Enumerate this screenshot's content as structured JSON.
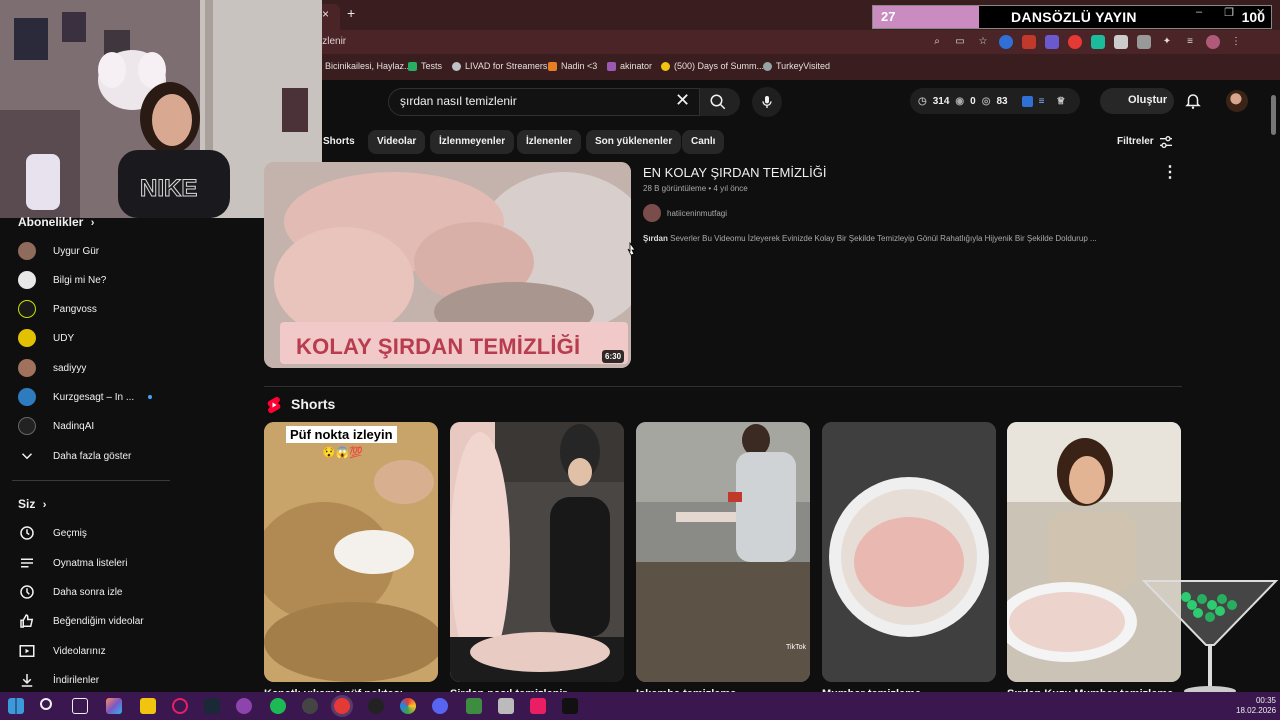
{
  "browser": {
    "tab_close_glyph": "×",
    "new_tab_glyph": "+",
    "url": "izlenir",
    "bookmarks": [
      {
        "label": "Bicinikailesi, Haylaz...",
        "color": "#c0392b"
      },
      {
        "label": "Tests",
        "color": "#27ae60"
      },
      {
        "label": "LIVAD for Streamers",
        "color": "#bdc3c7"
      },
      {
        "label": "Nadin <3",
        "color": "#e67e22"
      },
      {
        "label": "akinator",
        "color": "#9b59b6"
      },
      {
        "label": "(500) Days of Summ...",
        "color": "#f1c40f"
      },
      {
        "label": "TurkeyVisited",
        "color": "#95a5a6"
      }
    ],
    "window_controls": [
      "–",
      "❐",
      "✕"
    ]
  },
  "overlay": {
    "left_number": "27",
    "title": "DANSÖZLÜ YAYIN",
    "right_number": "100"
  },
  "header": {
    "search_value": "şırdan nasıl temizlenir",
    "stats": {
      "watch_count": "314",
      "views": "0",
      "other": "83"
    },
    "create_label": "Oluştur"
  },
  "chips": [
    "Shorts",
    "Videolar",
    "İzlenmeyenler",
    "İzlenenler",
    "Son yüklenenler",
    "Canlı"
  ],
  "filters_label": "Filtreler",
  "sidebar": {
    "subscriptions_heading": "Abonelikler",
    "subscriptions": [
      {
        "label": "Uygur Gür",
        "color": "#8e6b5a"
      },
      {
        "label": "Bilgi mi Ne?",
        "color": "#e8e8e8"
      },
      {
        "label": "Pangvoss",
        "color": "#1a1a1a"
      },
      {
        "label": "UDY",
        "color": "#e2c200"
      },
      {
        "label": "sadiyyy",
        "color": "#a0715c"
      },
      {
        "label": "Kurzgesagt – In ...",
        "color": "#2f7bbf"
      },
      {
        "label": "NadinqAI",
        "color": "#222"
      }
    ],
    "show_more": "Daha fazla göster",
    "you_heading": "Siz",
    "you_items": [
      "Geçmiş",
      "Oynatma listeleri",
      "Daha sonra izle",
      "Beğendiğim videolar",
      "Videolarınız",
      "İndirilenler"
    ]
  },
  "video": {
    "title": "EN KOLAY ŞIRDAN TEMİZLİĞİ",
    "views": "28 B görüntüleme",
    "age": "4 yıl önce",
    "channel": "hatiiceninmutfagi",
    "desc_bold": "Şırdan",
    "desc_rest": " Severler Bu Videomu İzleyerek Evinizde Kolay Bir Şekilde Temizleyip Gönül Rahatlığıyla Hijyenik Bir Şekilde Doldurup ...",
    "thumbnail_text": "KOLAY ŞIRDAN TEMİZLİĞİ",
    "duration": "6:30"
  },
  "shorts": {
    "heading": "Shorts",
    "first_overlay_text": "Püf nokta izleyin",
    "first_overlay_emoji": "😯😱💯",
    "tiktok_label": "TikTok",
    "items": [
      {
        "title": "Kanatlı yıkama püf noktası",
        "color": "#b99660"
      },
      {
        "title": "Şirdan nasıl temizlenir",
        "color": "#2b2b2b"
      },
      {
        "title": "Işkembe temizleme",
        "color": "#6d6e69"
      },
      {
        "title": "Mumbar temizleme",
        "color": "#4a4a4a"
      },
      {
        "title": "Şırdan Kuzu Mumbar temizleme",
        "color": "#a89f93"
      }
    ]
  },
  "clock": {
    "time": "00:35",
    "date": "18.02.2026"
  }
}
